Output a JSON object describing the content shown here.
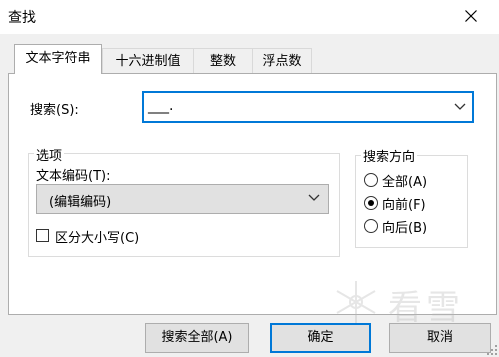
{
  "window": {
    "title": "查找",
    "close_icon": "close-icon"
  },
  "tabs": [
    {
      "label": "文本字符串",
      "active": true
    },
    {
      "label": "十六进制值",
      "active": false
    },
    {
      "label": "整数",
      "active": false
    },
    {
      "label": "浮点数",
      "active": false
    }
  ],
  "search": {
    "label": "搜索(S):",
    "value": "___.",
    "dropdown_icon": "chevron-down-icon"
  },
  "options": {
    "legend": "选项",
    "encoding_label": "文本编码(T):",
    "encoding_value": "(编辑编码)",
    "case_label": "区分大小写(C)",
    "case_checked": false
  },
  "direction": {
    "legend": "搜索方向",
    "items": [
      {
        "label": "全部(A)",
        "checked": false
      },
      {
        "label": "向前(F)",
        "checked": true
      },
      {
        "label": "向后(B)",
        "checked": false
      }
    ]
  },
  "buttons": {
    "search_all": "搜索全部(A)",
    "ok": "确定",
    "cancel": "取消"
  },
  "watermark": {
    "text": "看雪",
    "icon": "snowflake-icon"
  },
  "colors": {
    "accent": "#0078d7",
    "dialog_bg": "#f0f0f0",
    "button_bg": "#e1e1e1"
  }
}
